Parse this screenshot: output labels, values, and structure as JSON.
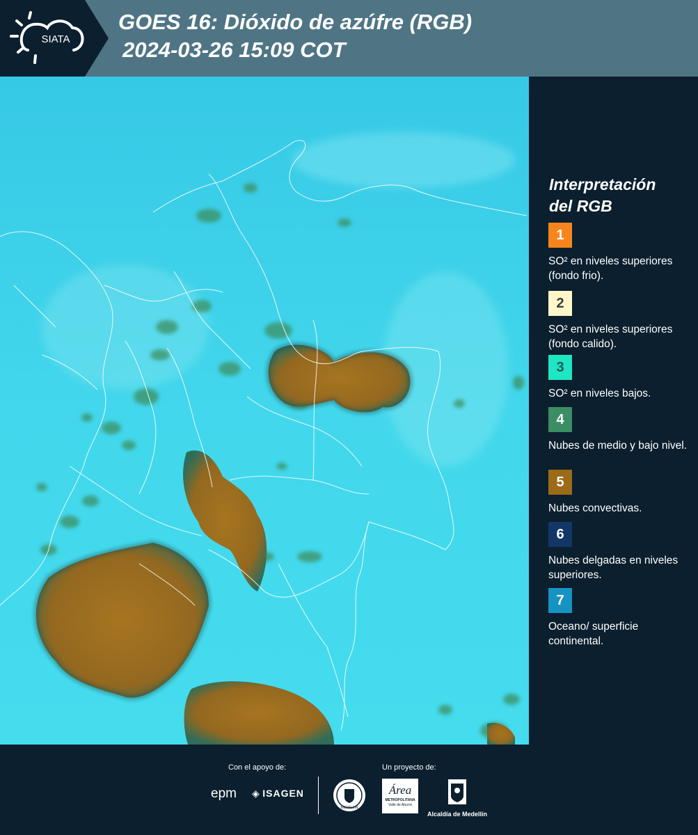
{
  "header": {
    "logo_text": "SIATA",
    "title_line1": "GOES 16: Dióxido de azúfre (RGB)",
    "title_line2": "2024-03-26 15:09 COT"
  },
  "legend": {
    "title_line1": "Interpretación",
    "title_line2": "del RGB",
    "items": [
      {
        "number": "1",
        "text": "SO² en niveles superiores (fondo frio).",
        "color": "#f7851e",
        "num_color": "#ffffff"
      },
      {
        "number": "2",
        "text": "SO² en niveles superiores (fondo calido).",
        "color": "#fff7c9",
        "num_color": "#3a3a3a"
      },
      {
        "number": "3",
        "text": "SO² en niveles bajos.",
        "color": "#1fe6c3",
        "num_color": "#1d5a5a"
      },
      {
        "number": "4",
        "text": "Nubes de medio y bajo nivel.",
        "color": "#3b8d64",
        "num_color": "#ffffff"
      },
      {
        "number": "5",
        "text": "Nubes convectivas.",
        "color": "#9c6b17",
        "num_color": "#ffffff"
      },
      {
        "number": "6",
        "text": "Nubes delgadas en niveles superiores.",
        "color": "#123767",
        "num_color": "#ffffff"
      },
      {
        "number": "7",
        "text": "Oceano/ superficie continental.",
        "color": "#1693c2",
        "num_color": "#ffffff"
      }
    ]
  },
  "footer": {
    "support_caption": "Con el apoyo de:",
    "project_caption": "Un proyecto de:",
    "epm_text": "epm",
    "isagen_text": "ISAGEN",
    "area_text": "Área",
    "area_sub1": "METROPOLITANA",
    "area_sub2": "Valle de Aburrá",
    "alcaldia_text": "Alcaldía de Medellín",
    "seal_text": "MEDELLIN"
  },
  "colors": {
    "header_bg": "#4f7585",
    "panel_bg": "#0b1f2e",
    "cyan": "#3fd6e9",
    "convective": "#9c6b17"
  }
}
